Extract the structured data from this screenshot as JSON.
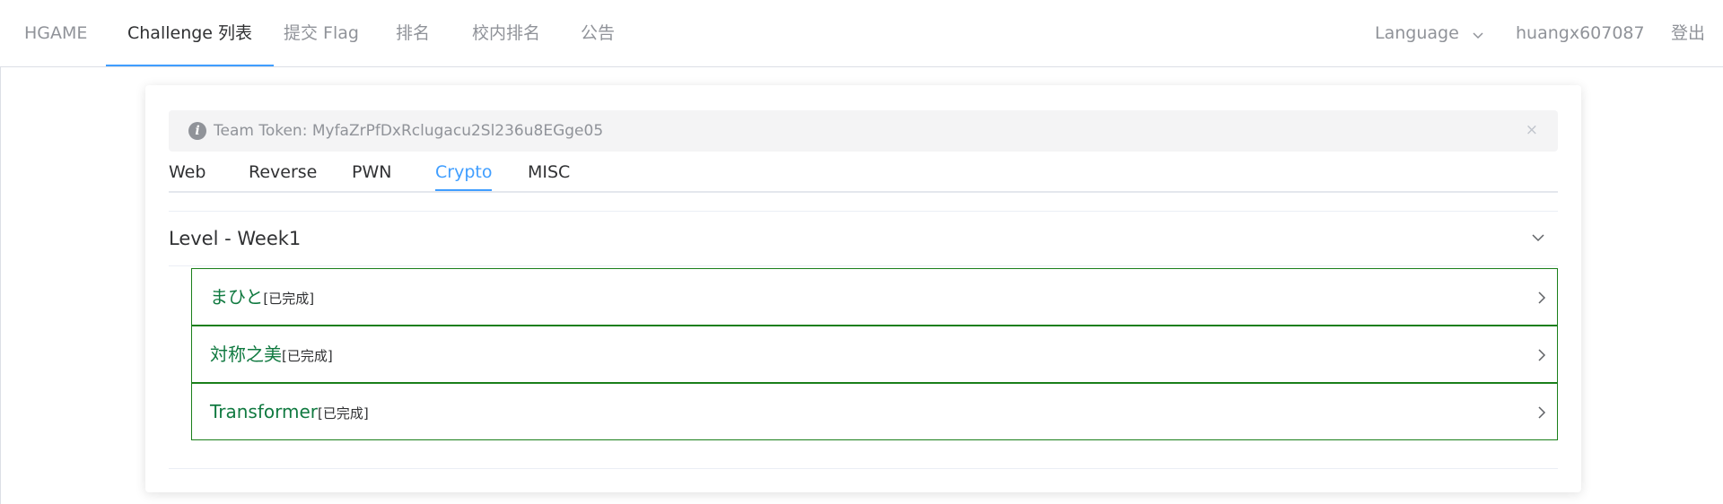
{
  "nav": {
    "brand": "HGAME",
    "items": [
      {
        "label": "Challenge 列表",
        "active": true
      },
      {
        "label": "提交 Flag",
        "active": false
      },
      {
        "label": "排名",
        "active": false
      },
      {
        "label": "校内排名",
        "active": false
      },
      {
        "label": "公告",
        "active": false
      }
    ],
    "language": "Language",
    "username": "huangx607087",
    "logout": "登出"
  },
  "alert": {
    "text": "Team Token: MyfaZrPfDxRclugacu2Sl236u8EGge05",
    "close": "×"
  },
  "tabs": [
    "Web",
    "Reverse",
    "PWN",
    "Crypto",
    "MISC"
  ],
  "active_tab": "Crypto",
  "level": {
    "title": "Level - Week1",
    "challenges": [
      {
        "name": "まひと",
        "status": "[已完成]"
      },
      {
        "name": "対称之美",
        "status": "[已完成]"
      },
      {
        "name": "Transformer",
        "status": "[已完成]"
      }
    ]
  },
  "colors": {
    "accent": "#409eff",
    "solved_border": "#1a7f1a",
    "solved_text": "#117a41"
  }
}
